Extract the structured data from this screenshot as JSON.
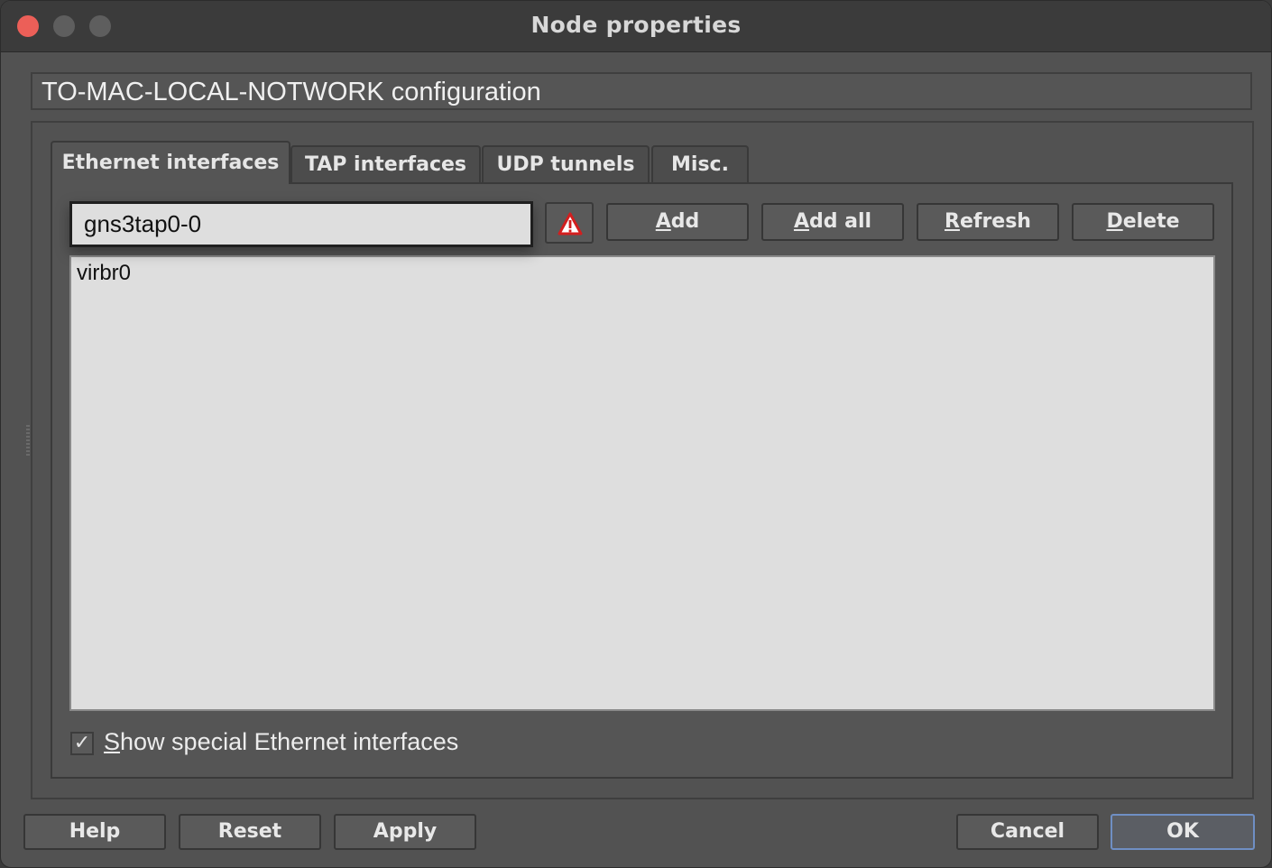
{
  "window": {
    "title": "Node properties"
  },
  "config": {
    "header": "TO-MAC-LOCAL-NOTWORK configuration"
  },
  "tabs": [
    {
      "label": "Ethernet interfaces",
      "active": true
    },
    {
      "label": "TAP interfaces",
      "active": false
    },
    {
      "label": "UDP tunnels",
      "active": false
    },
    {
      "label": "Misc.",
      "active": false
    }
  ],
  "ethernet": {
    "interface_value": "gns3tap0-0",
    "warning_icon": "warning-triangle-icon",
    "buttons": {
      "add_mnemonic": "A",
      "add_rest": "dd",
      "add_all_mnemonic": "A",
      "add_all_rest": "dd all",
      "refresh_mnemonic": "R",
      "refresh_rest": "efresh",
      "delete_mnemonic": "D",
      "delete_rest": "elete"
    },
    "list_items": [
      "virbr0"
    ],
    "show_special": {
      "checked": true,
      "check_glyph": "✓",
      "label_mnemonic": "S",
      "label_rest": "how special Ethernet interfaces"
    }
  },
  "footer": {
    "help": "Help",
    "reset": "Reset",
    "apply": "Apply",
    "cancel": "Cancel",
    "ok": "OK"
  },
  "colors": {
    "close_button": "#ec5f58",
    "warning_red": "#d21e1e",
    "default_button_border": "#6f8fc4"
  }
}
